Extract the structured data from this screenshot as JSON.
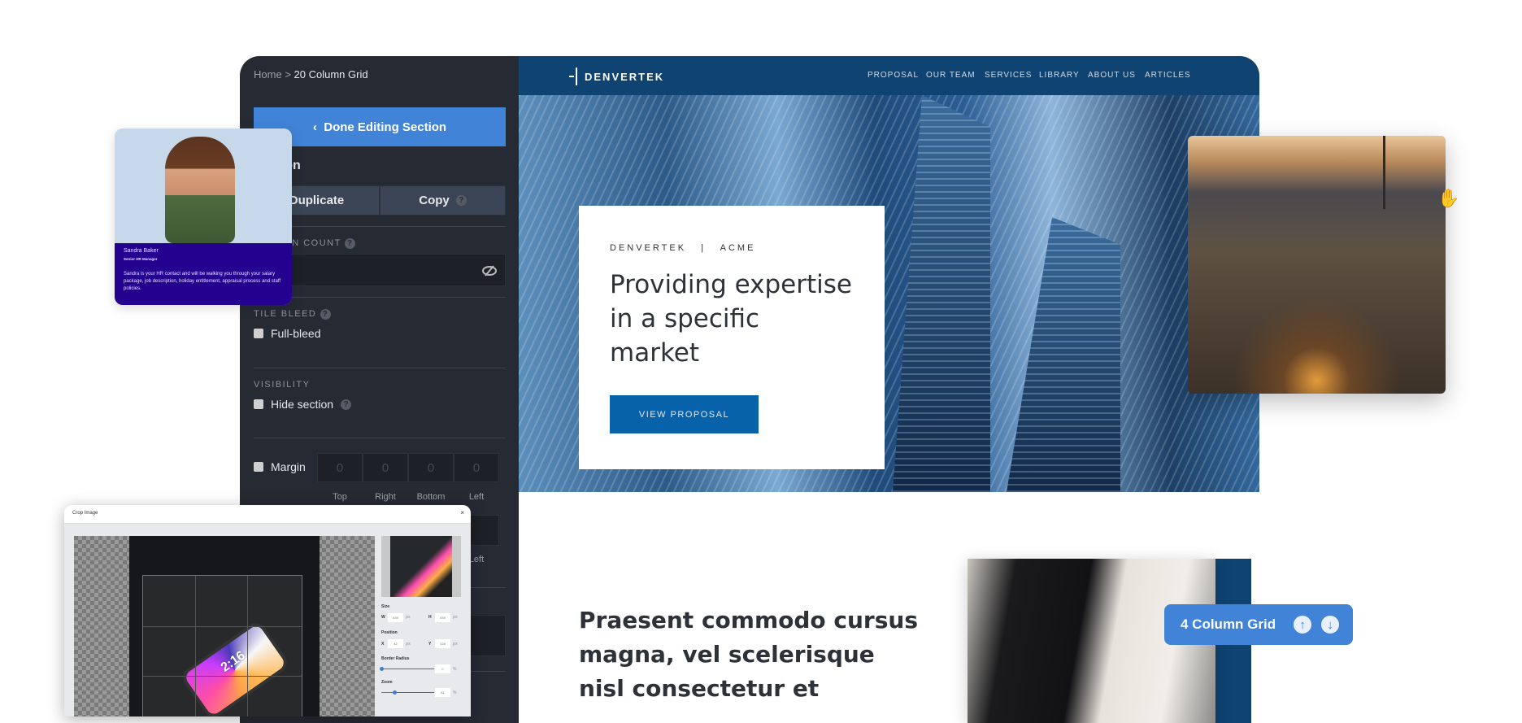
{
  "editor": {
    "breadcrumb": {
      "home": "Home",
      "separator": ">",
      "current": "20 Column Grid"
    },
    "done_button": "Done Editing Section",
    "done_chevron": "‹",
    "section_heading": "Section",
    "duplicate_button": "Duplicate",
    "copy_button": "Copy",
    "help": "?",
    "column_count_label": "COLUMN COUNT",
    "tile_bleed_label": "TILE BLEED",
    "full_bleed": "Full-bleed",
    "visibility_label": "VISIBILITY",
    "hide_section": "Hide section",
    "margin_label": "Margin",
    "margin_values": [
      "0",
      "0",
      "0",
      "0"
    ],
    "margin_sides": [
      "Top",
      "Right",
      "Bottom",
      "Left"
    ],
    "extra_left": "Left"
  },
  "site": {
    "logo": "DENVERTEK",
    "nav": [
      "PROPOSAL",
      "OUR TEAM",
      "SERVICES",
      "LIBRARY",
      "ABOUT US",
      "ARTICLES"
    ],
    "eyebrow": "DENVERTEK   |   ACME",
    "headline": "Providing expertise in a specific market",
    "cta": "VIEW PROPOSAL",
    "lower_text": "Praesent commodo cursus magna, vel scelerisque nisl consectetur et"
  },
  "person_card": {
    "name": "Sandra Baker",
    "role": "Senior HR Manager",
    "bio": "Sandra is your HR contact and will be walking you through your salary package, job description, holiday entitlement, appraisal process and staff policies."
  },
  "crop": {
    "title": "Crop Image",
    "close": "×",
    "size_label": "Size",
    "w_label": "W",
    "w": "539",
    "h_label": "H",
    "h": "539",
    "unit": "px",
    "position_label": "Position",
    "x_label": "X",
    "x": "42",
    "y_label": "Y",
    "y": "128",
    "radius_label": "Border Radius",
    "radius": "0",
    "zoom_label": "Zoom",
    "zoom": "81",
    "pct": "%",
    "phone_time": "2:16"
  },
  "grid_badge": {
    "label": "4 Column Grid",
    "up": "↑",
    "down": "↓"
  },
  "colors": {
    "accent": "#4183d7",
    "navy": "#0e4372",
    "panel": "#262a33",
    "purple": "#24028f"
  }
}
